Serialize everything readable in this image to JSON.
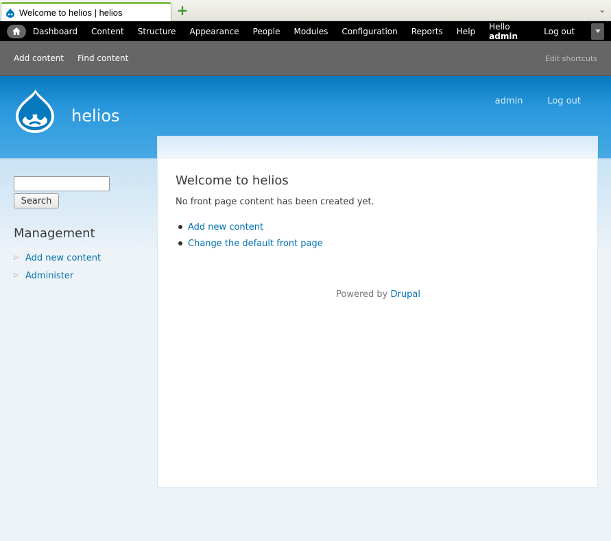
{
  "browser": {
    "tab_title": "Welcome to helios | helios",
    "new_tab_glyph": "+",
    "tab_menu_glyph": "⌄"
  },
  "toolbar": {
    "items": [
      "Dashboard",
      "Content",
      "Structure",
      "Appearance",
      "People",
      "Modules",
      "Configuration",
      "Reports",
      "Help"
    ],
    "hello_prefix": "Hello",
    "user": "admin",
    "logout": "Log out"
  },
  "shortcuts": {
    "items": [
      "Add content",
      "Find content"
    ],
    "edit": "Edit shortcuts"
  },
  "header": {
    "site_name": "helios",
    "secondary_menu": [
      "admin",
      "Log out"
    ]
  },
  "sidebar": {
    "search_button": "Search",
    "block_title": "Management",
    "menu": [
      "Add new content",
      "Administer"
    ]
  },
  "main": {
    "title": "Welcome to helios",
    "message": "No front page content has been created yet.",
    "links": [
      "Add new content",
      "Change the default front page"
    ],
    "footer_prefix": "Powered by",
    "footer_link": "Drupal"
  },
  "colors": {
    "link": "#0071b3",
    "toolbar_bg": "#000000",
    "shortcut_bg": "#666666",
    "header_blue": "#0779bf"
  }
}
